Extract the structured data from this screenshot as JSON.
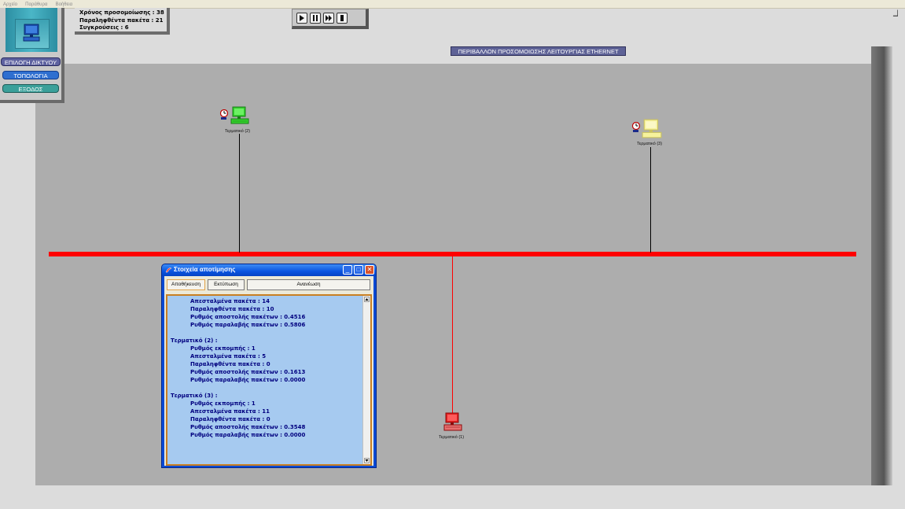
{
  "menu": [
    "Αρχείο",
    "Παράθυρα",
    "Βοήθεια"
  ],
  "stats": [
    "Χρόνος προσομοίωσης : 38",
    "Παραληφθέντα πακέτα : 21",
    "Συγκρούσεις : 6"
  ],
  "player": {
    "buttons": [
      {
        "name": "play-icon"
      },
      {
        "name": "pause-icon"
      },
      {
        "name": "fast-forward-icon"
      },
      {
        "name": "stop-icon"
      }
    ]
  },
  "left_panel": {
    "logo_icon": "computer-icon",
    "buttons": [
      {
        "label": "ΕΠΙΛΟΓΗ ΔΙΚΤΥΟΥ",
        "color": "#5e62a0"
      },
      {
        "label": "ΤΟΠΟΛΟΓΙΑ",
        "color": "#2e6fd0"
      },
      {
        "label": "ΕΞΟΔΟΣ",
        "color": "#3aa09a"
      }
    ]
  },
  "banner": "ΠΕΡΙΒΑΛΛΟΝ ΠΡΟΣΟΜΟΙΩΣΗΣ ΛΕΙΤΟΥΡΓΙΑΣ ETHERNET",
  "terminals": [
    {
      "label": "Τερματικό (1)",
      "color": "#e02020"
    },
    {
      "label": "Τερματικό (2)",
      "color": "#33d12c"
    },
    {
      "label": "Τερματικό (3)",
      "color": "#f6f29c"
    }
  ],
  "colors": {
    "bus": "#ff0000",
    "area": "#adadad",
    "dialog_text": "#00007f",
    "dialog_bg": "#a6caf0"
  },
  "dialog": {
    "title": "Στοιχεία αποτίμησης",
    "buttons": {
      "save": "Αποθήκευση",
      "print": "Εκτύπωση",
      "refresh": "Ανανέωση"
    },
    "lines": [
      {
        "text": "Απεσταλμένα πακέτα : 14",
        "indent": true
      },
      {
        "text": "Παραληφθέντα πακέτα : 10",
        "indent": true
      },
      {
        "text": "Ρυθμός αποστολής πακέτων : 0.4516",
        "indent": true
      },
      {
        "text": "Ρυθμός παραλαβής πακέτων : 0.5806",
        "indent": true
      },
      {
        "text": "",
        "indent": false
      },
      {
        "text": "Τερματικό (2) :",
        "indent": false
      },
      {
        "text": "Ρυθμός εκπομπής : 1",
        "indent": true
      },
      {
        "text": "Απεσταλμένα πακέτα : 5",
        "indent": true
      },
      {
        "text": "Παραληφθέντα πακέτα : 0",
        "indent": true
      },
      {
        "text": "Ρυθμός αποστολής πακέτων : 0.1613",
        "indent": true
      },
      {
        "text": "Ρυθμός παραλαβής πακέτων : 0.0000",
        "indent": true
      },
      {
        "text": "",
        "indent": false
      },
      {
        "text": "Τερματικό (3) :",
        "indent": false
      },
      {
        "text": "Ρυθμός εκπομπής : 1",
        "indent": true
      },
      {
        "text": "Απεσταλμένα πακέτα : 11",
        "indent": true
      },
      {
        "text": "Παραληφθέντα πακέτα : 0",
        "indent": true
      },
      {
        "text": "Ρυθμός αποστολής πακέτων : 0.3548",
        "indent": true
      },
      {
        "text": "Ρυθμός παραλαβής πακέτων : 0.0000",
        "indent": true
      }
    ]
  }
}
